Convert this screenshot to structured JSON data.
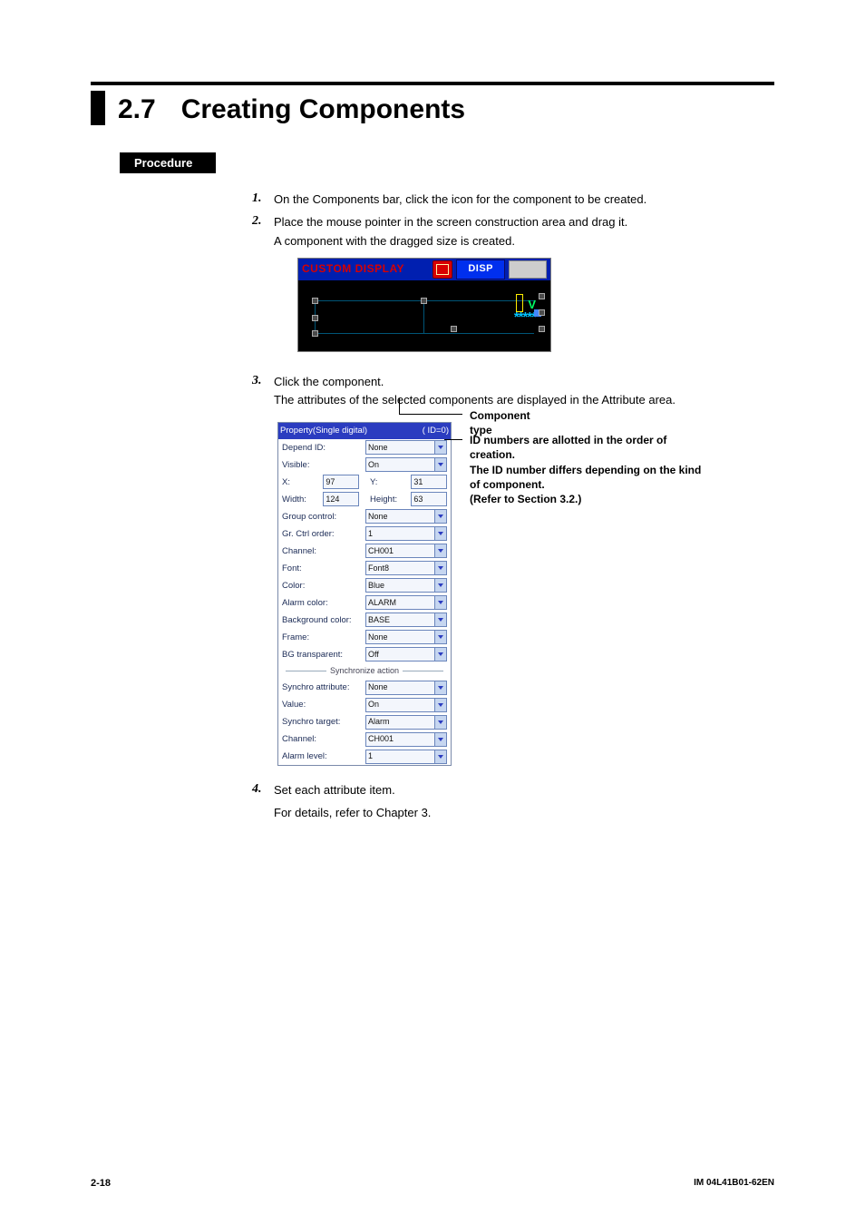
{
  "section_number": "2.7",
  "section_title": "Creating Components",
  "procedure_label": "Procedure",
  "steps": {
    "s1": {
      "num": "1.",
      "text": "On the Components bar, click the icon for the component to be created."
    },
    "s2": {
      "num": "2.",
      "text": "Place the mouse pointer in the screen construction area and drag it.",
      "sub": "A component with the dragged size is created."
    },
    "s3": {
      "num": "3.",
      "text": "Click the component.",
      "sub": "The attributes of the selected components are displayed in the Attribute area."
    },
    "s4": {
      "num": "4.",
      "text": "Set each attribute item.",
      "sub": "For details, refer to Chapter 3."
    }
  },
  "custom_display": {
    "title": "CUSTOM DISPLAY",
    "disp": "DISP"
  },
  "attr_panel": {
    "header_left": "Property(Single digital)",
    "header_right": "( ID=0)",
    "rows": [
      {
        "label": "Depend ID:",
        "value": "None",
        "type": "drop"
      },
      {
        "label": "Visible:",
        "value": "On",
        "type": "drop"
      }
    ],
    "xy1": {
      "l1": "X:",
      "v1": "97",
      "l2": "Y:",
      "v2": "31"
    },
    "xy2": {
      "l1": "Width:",
      "v1": "124",
      "l2": "Height:",
      "v2": "63"
    },
    "rows2": [
      {
        "label": "Group control:",
        "value": "None",
        "type": "drop"
      },
      {
        "label": "Gr. Ctrl order:",
        "value": "1",
        "type": "drop"
      },
      {
        "label": "Channel:",
        "value": "CH001",
        "type": "drop"
      },
      {
        "label": "Font:",
        "value": "Font8",
        "type": "drop"
      },
      {
        "label": "Color:",
        "value": "Blue",
        "type": "drop"
      },
      {
        "label": "Alarm color:",
        "value": "ALARM",
        "type": "drop"
      },
      {
        "label": "Background color:",
        "value": "BASE",
        "type": "drop"
      },
      {
        "label": "Frame:",
        "value": "None",
        "type": "drop"
      },
      {
        "label": "BG transparent:",
        "value": "Off",
        "type": "drop"
      }
    ],
    "sync_divider": "Synchronize action",
    "rows3": [
      {
        "label": "Synchro attribute:",
        "value": "None",
        "type": "drop"
      },
      {
        "label": "Value:",
        "value": "On",
        "type": "drop"
      },
      {
        "label": "Synchro target:",
        "value": "Alarm",
        "type": "drop"
      },
      {
        "label": "Channel:",
        "value": "CH001",
        "type": "drop"
      },
      {
        "label": "Alarm level:",
        "value": "1",
        "type": "drop"
      }
    ]
  },
  "callouts": {
    "component_type": "Component type",
    "id_note": "ID numbers are allotted in the order of creation.\nThe ID number differs depending on the kind of component.\n(Refer to Section 3.2.)"
  },
  "footer": {
    "left": "2-18",
    "right": "IM 04L41B01-62EN"
  }
}
